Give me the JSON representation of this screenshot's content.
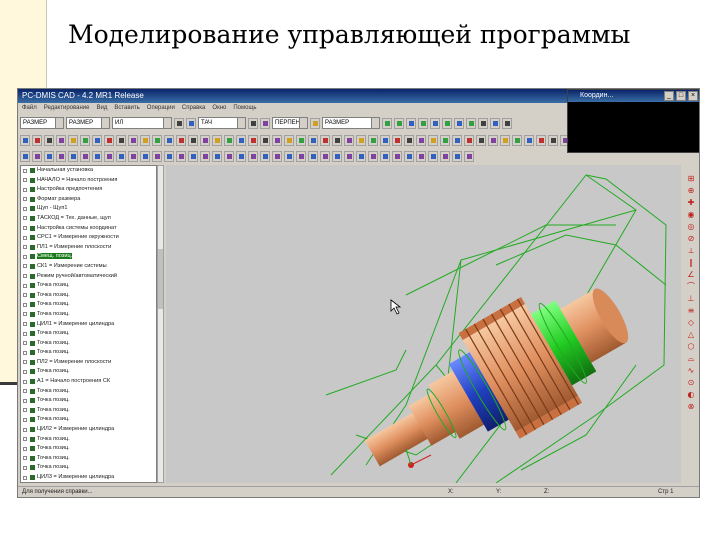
{
  "slide": {
    "title": "Моделирование управляющей программы"
  },
  "window": {
    "title": "PC-DMIS CAD - 4.2 MR1 Release"
  },
  "menu": [
    "Файл",
    "Редактирование",
    "Вид",
    "Вставить",
    "Операции",
    "Справка",
    "Окно",
    "Помощь"
  ],
  "toolbar1": {
    "combo1": "РАЗМЕР",
    "combo2": "РАЗМЕР",
    "combo3": "ИЛ",
    "combo4": "ТАЧ",
    "combo5": "ПЕРПЕНД",
    "combo6": "РАЗМЕР"
  },
  "coord_window": {
    "title": "Координ...",
    "buttons": [
      "_",
      "□",
      "×"
    ]
  },
  "tree": {
    "items": [
      {
        "text": "Начальная установка"
      },
      {
        "text": "НАЧАЛО = Начало построения"
      },
      {
        "text": "Настройка предпочтения"
      },
      {
        "text": "Формат размера"
      },
      {
        "text": "Щуп - Щуп1"
      },
      {
        "text": "ТАСКОД = Тех. данные, щуп"
      },
      {
        "text": "Настройка системы координат"
      },
      {
        "text": "СРС1 = Измерение окружности"
      },
      {
        "text": "ПЛ1 = Измерение плоскости"
      },
      {
        "text": "Смещ. позиц.",
        "selected": true
      },
      {
        "text": "СК1 = Измерение системы"
      },
      {
        "text": "Режим ручной/автоматический"
      },
      {
        "text": "Точка позиц."
      },
      {
        "text": "Точка позиц."
      },
      {
        "text": "Точка позиц."
      },
      {
        "text": "Точка позиц."
      },
      {
        "text": "ЦИЛ1 = Измерение цилиндра"
      },
      {
        "text": "Точка позиц."
      },
      {
        "text": "Точка позиц."
      },
      {
        "text": "Точка позиц."
      },
      {
        "text": "ПЛ2 = Измерение плоскости"
      },
      {
        "text": "Точка позиц."
      },
      {
        "text": "А1 = Начало построения СК"
      },
      {
        "text": "Точка позиц."
      },
      {
        "text": "Точка позиц."
      },
      {
        "text": "Точка позиц."
      },
      {
        "text": "Точка позиц."
      },
      {
        "text": "ЦИЛ2 = Измерение цилиндра"
      },
      {
        "text": "Точка позиц."
      },
      {
        "text": "Точка позиц."
      },
      {
        "text": "Точка позиц."
      },
      {
        "text": "Точка позиц."
      },
      {
        "text": "ЦИЛ3 = Измерение цилиндра"
      }
    ]
  },
  "status": {
    "left": "Для получения справки...",
    "x": "X:",
    "y": "Y:",
    "z": "Z:",
    "right": "Стр 1"
  },
  "colors": {
    "wireframe": "#22aa22",
    "part": "#e8a070",
    "gear_band": "#2244cc",
    "highlight": "#33dd33"
  }
}
